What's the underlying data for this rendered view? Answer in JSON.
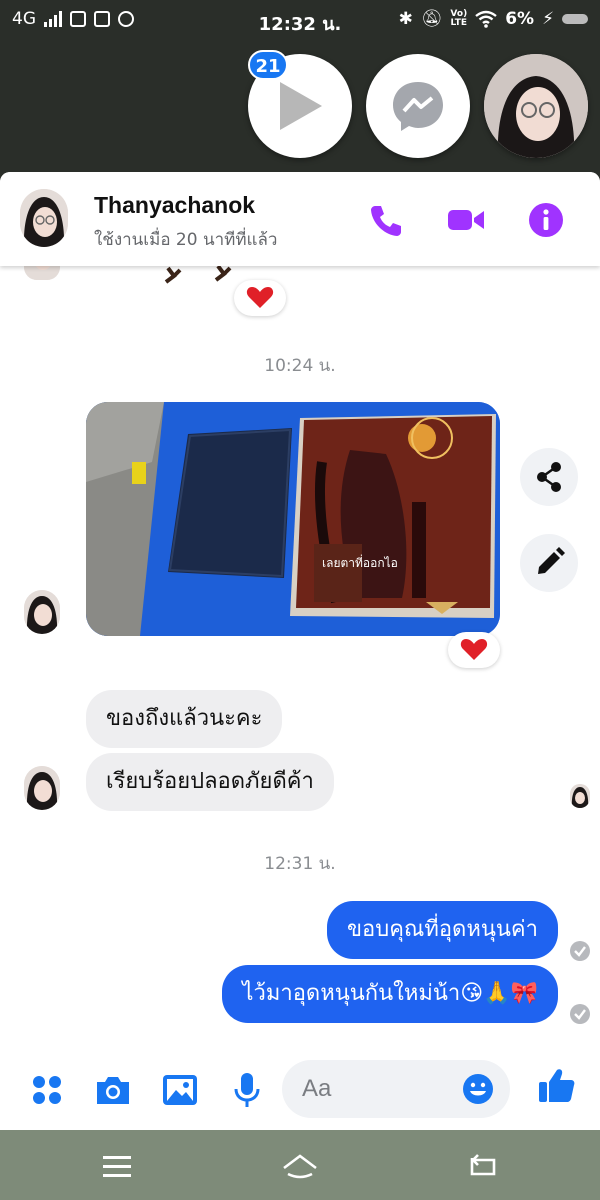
{
  "status_bar": {
    "network": "4G",
    "time": "12:32 น.",
    "volte": "Vo)",
    "volte_sub": "LTE",
    "battery": "6%"
  },
  "chat_heads": {
    "unread_badge": "21"
  },
  "header": {
    "contact_name": "Thanyachanok",
    "status": "ใช้งานเมื่อ 20 นาทีที่แล้ว"
  },
  "messages": {
    "time_1": "10:24 น.",
    "photo_book_title": "เลยตาที่ออกไอ",
    "incoming_1": "ของถึงแล้วนะคะ",
    "incoming_2": "เรียบร้อยปลอดภัยดีค้า",
    "time_2": "12:31 น.",
    "outgoing_1": "ขอบคุณที่อุดหนุนค่า",
    "outgoing_2": "ไว้มาอุดหนุนกันใหม่น้า😘🙏🎀"
  },
  "composer": {
    "placeholder": "Aa"
  },
  "colors": {
    "messenger_blue": "#1877f2",
    "outgoing_bubble": "#1f63f0",
    "header_icon_purple": "#a033ff",
    "nav_bar": "#7e8b79"
  },
  "icons": [
    "phone-icon",
    "video-camera-icon",
    "info-icon",
    "share-icon",
    "edit-pencil-icon",
    "apps-grid-icon",
    "camera-icon",
    "gallery-icon",
    "microphone-icon",
    "emoji-icon",
    "thumbs-up-icon",
    "heart-icon",
    "menu-icon",
    "home-icon",
    "back-icon"
  ]
}
